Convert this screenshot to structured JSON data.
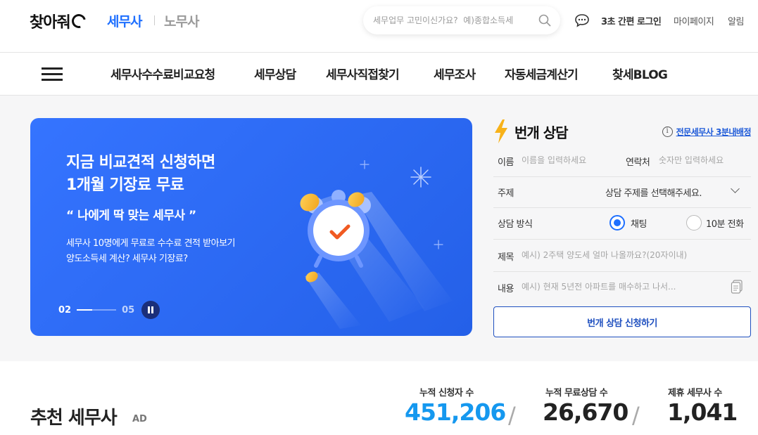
{
  "header": {
    "logo_text": "찾아줘",
    "brand_tax": "세무사",
    "brand_labor": "노무사",
    "search_placeholder": "세무업무 고민이신가요?  예)종합소득세",
    "quick_login": "3초 간편 로그인",
    "mypage": "마이페이지",
    "alarm": "알림"
  },
  "nav": {
    "items": [
      {
        "label": "세무사수수료비교요청"
      },
      {
        "label": "세무상담"
      },
      {
        "label": "세무사직접찾기"
      },
      {
        "label": "세무조사"
      },
      {
        "label": "자동세금계산기"
      },
      {
        "label": "찾세BLOG"
      }
    ]
  },
  "banner": {
    "title_line1": "지금 비교견적 신청하면",
    "title_line2": "1개월 기장료 무료",
    "quote": "“ 나에게 딱 맞는 세무사 ”",
    "desc_line1": "세무사 10명에게 무료로 수수료 견적 받아보기",
    "desc_line2": "양도소득세 계산? 세무사 기장료?",
    "pager_current": "02",
    "pager_total": "05",
    "pager_progress": 0.4
  },
  "consult": {
    "title": "번개 상담",
    "info_label": "전문세무사 3분내배정",
    "name_label": "이름",
    "name_placeholder": "이름을 입력하세요",
    "contact_label": "연락처",
    "contact_placeholder": "숫자만 입력하세요",
    "topic_label": "주제",
    "topic_value": "상담 주제를 선택해주세요.",
    "method_label": "상담 방식",
    "method_options": [
      {
        "label": "채팅",
        "selected": true
      },
      {
        "label": "10분 전화",
        "selected": false
      }
    ],
    "subject_label": "제목",
    "subject_placeholder": "예시) 2주택 양도세 얼마 나올까요?(20자이내)",
    "content_label": "내용",
    "content_placeholder": "예시) 현재 5년전 아파트를 매수하고 나서...",
    "submit_label": "번개 상담 신청하기"
  },
  "recommend": {
    "title": "추천 세무사",
    "ad_badge": "AD"
  },
  "stats": [
    {
      "label": "누적 신청자 수",
      "value": "451,206"
    },
    {
      "label": "누적 무료상담 수",
      "value": "26,670"
    },
    {
      "label": "제휴 세무사 수",
      "value": "1,041"
    }
  ],
  "stat_separator": "/",
  "colors": {
    "brand_blue": "#1e6fff",
    "banner_blue": "#2f6cf5",
    "stat_blue": "#1598ef",
    "submit_border": "#1e4fbf"
  }
}
